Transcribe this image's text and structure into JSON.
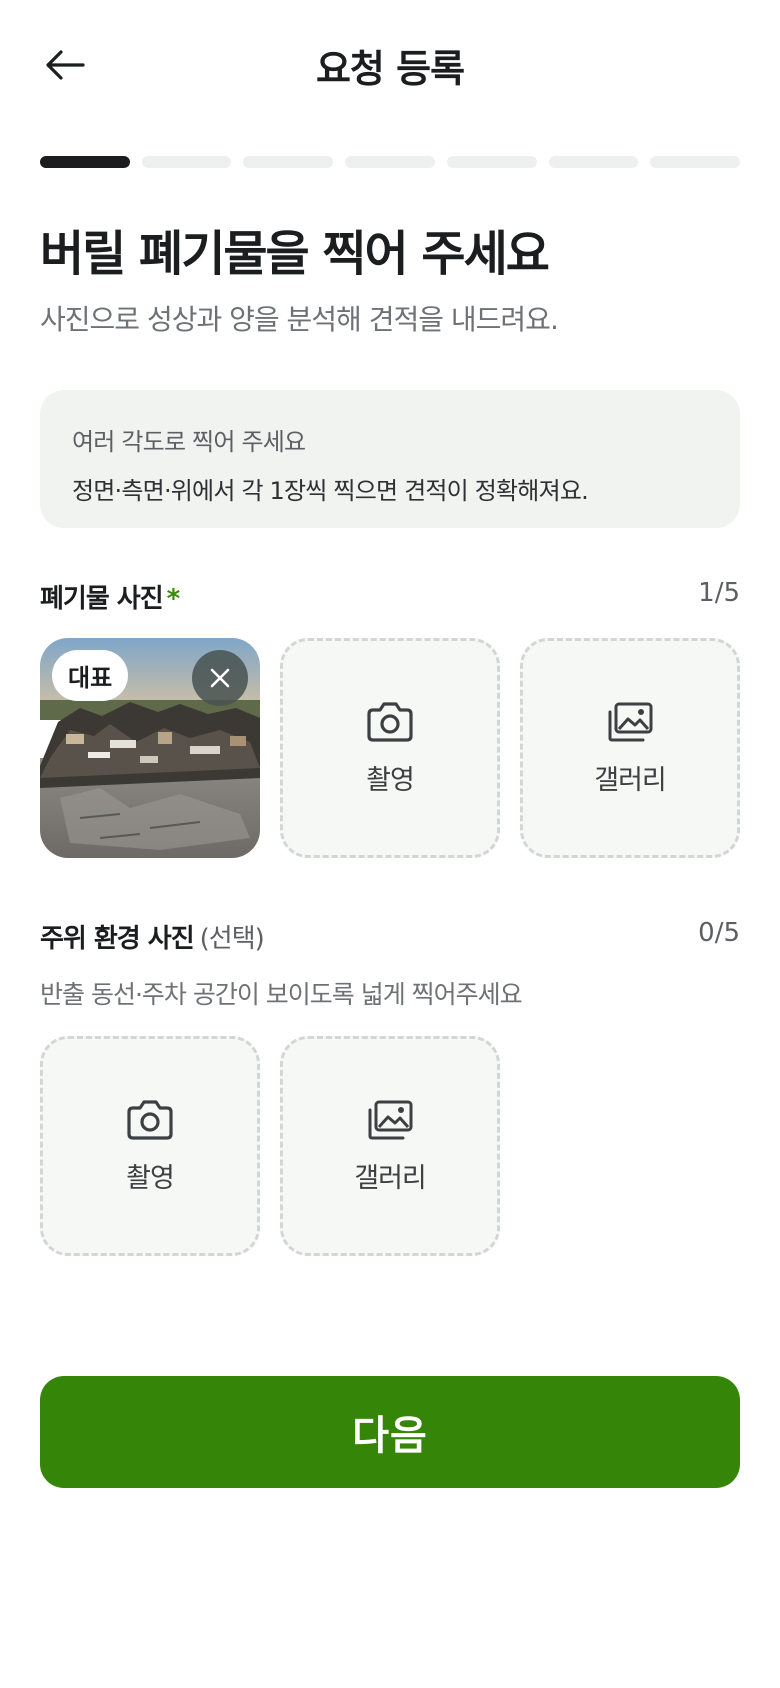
{
  "header": {
    "title": "요청 등록",
    "back_icon": "arrow-left-icon"
  },
  "progress": {
    "current_step": 1,
    "total_steps": 7
  },
  "main": {
    "title": "버릴 폐기물을 찍어 주세요",
    "subtitle": "사진으로 성상과 양을 분석해 견적을 내드려요."
  },
  "tip": {
    "heading": "여러 각도로 찍어 주세요",
    "body": "정면·측면·위에서 각 1장씩 찍으면 견적이 정확해져요."
  },
  "waste_photos": {
    "label": "폐기물 사진",
    "required_mark": "*",
    "count": "1/5",
    "photo_badge": "대표",
    "camera_label": "촬영",
    "gallery_label": "갤러리"
  },
  "surroundings_photos": {
    "label": "주위 환경 사진",
    "optional_label": "(선택)",
    "count": "0/5",
    "helper": "반출 동선·주차 공간이 보이도록 넓게 찍어주세요",
    "camera_label": "촬영",
    "gallery_label": "갤러리"
  },
  "footer": {
    "next_label": "다음"
  },
  "colors": {
    "accent": "#358508",
    "required": "#3a8a10",
    "active_progress": "#1b1d1f"
  }
}
